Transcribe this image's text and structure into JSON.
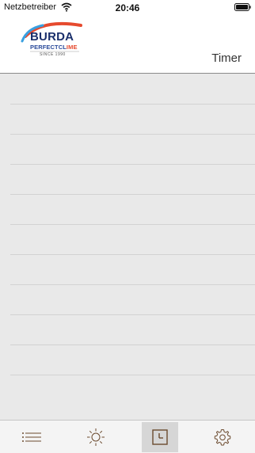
{
  "status_bar": {
    "carrier": "Netzbetreiber",
    "time": "20:46",
    "wifi_icon": "wifi-icon",
    "battery_icon": "battery-icon"
  },
  "header": {
    "logo": {
      "brand": "BURDA",
      "tagline_part1": "PERFECTCL",
      "tagline_part2": "IME",
      "since": "SINCE 1990"
    },
    "title": "Timer"
  },
  "timer_list": {
    "row_count": 10
  },
  "tab_bar": {
    "tabs": [
      {
        "icon": "list-icon",
        "active": false
      },
      {
        "icon": "sun-icon",
        "active": false
      },
      {
        "icon": "clock-icon",
        "active": true
      },
      {
        "icon": "gear-icon",
        "active": false
      }
    ]
  },
  "colors": {
    "accent_brown": "#6b4a2e",
    "logo_blue": "#1a2f6b",
    "logo_red": "#e64a2e",
    "background": "#e9e9e9"
  }
}
